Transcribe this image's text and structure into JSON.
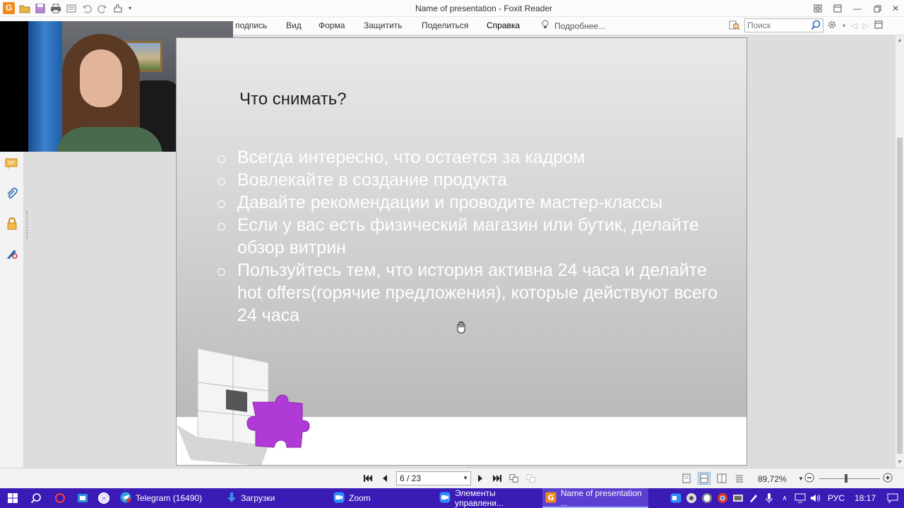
{
  "window": {
    "title": "Name of presentation - Foxit Reader"
  },
  "ribbon": {
    "tabs": [
      "подпись",
      "Вид",
      "Форма",
      "Защитить",
      "Поделиться",
      "Справка"
    ],
    "tell_me": "Подробнее...",
    "search_placeholder": "Поиск"
  },
  "slide": {
    "title": "Что снимать?",
    "bullets": [
      "Всегда интересно, что остается за кадром",
      "Вовлекайте в создание продукта",
      "Давайте рекомендации и проводите мастер-классы",
      "Если у вас есть физический магазин или бутик, делайте обзор витрин",
      "Пользуйтесь тем, что история активна 24 часа и делайте hot offers(горячие предложения), которые действуют всего 24 часа"
    ]
  },
  "status": {
    "page_indicator": "6 / 23",
    "zoom": "89,72%"
  },
  "taskbar": {
    "items": [
      {
        "label": "Telegram (16490)",
        "icon": "telegram-icon"
      },
      {
        "label": "Загрузки",
        "icon": "download-icon"
      },
      {
        "label": "Zoom",
        "icon": "zoom-icon"
      },
      {
        "label": "Элементы управлени...",
        "icon": "zoom-icon"
      },
      {
        "label": "Name of presentation ...",
        "icon": "foxit-icon"
      }
    ],
    "language": "РУС",
    "clock": "18:17"
  },
  "colors": {
    "taskbar": "#3a1bb5",
    "foxit_orange": "#f08a1a",
    "puzzle_purple": "#b03ad6"
  }
}
